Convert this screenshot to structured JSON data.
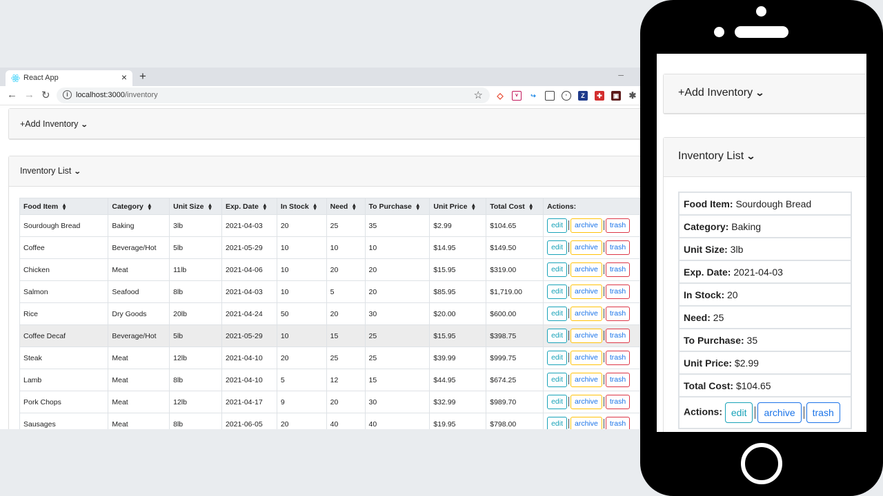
{
  "browser": {
    "tab_title": "React App",
    "url_host": "localhost:3000",
    "url_path": "/inventory"
  },
  "add_inventory_label": "+Add Inventory",
  "inventory_list_label": "Inventory List",
  "actions_header": "Actions:",
  "buttons": {
    "edit": "edit",
    "archive": "archive",
    "trash": "trash"
  },
  "columns": [
    "Food Item",
    "Category",
    "Unit Size",
    "Exp. Date",
    "In Stock",
    "Need",
    "To Purchase",
    "Unit Price",
    "Total Cost"
  ],
  "rows": [
    [
      "Sourdough Bread",
      "Baking",
      "3lb",
      "2021-04-03",
      "20",
      "25",
      "35",
      "$2.99",
      "$104.65"
    ],
    [
      "Coffee",
      "Beverage/Hot",
      "5lb",
      "2021-05-29",
      "10",
      "10",
      "10",
      "$14.95",
      "$149.50"
    ],
    [
      "Chicken",
      "Meat",
      "11lb",
      "2021-04-06",
      "10",
      "20",
      "20",
      "$15.95",
      "$319.00"
    ],
    [
      "Salmon",
      "Seafood",
      "8lb",
      "2021-04-03",
      "10",
      "5",
      "20",
      "$85.95",
      "$1,719.00"
    ],
    [
      "Rice",
      "Dry Goods",
      "20lb",
      "2021-04-24",
      "50",
      "20",
      "30",
      "$20.00",
      "$600.00"
    ],
    [
      "Coffee Decaf",
      "Beverage/Hot",
      "5lb",
      "2021-05-29",
      "10",
      "15",
      "25",
      "$15.95",
      "$398.75"
    ],
    [
      "Steak",
      "Meat",
      "12lb",
      "2021-04-10",
      "20",
      "25",
      "25",
      "$39.99",
      "$999.75"
    ],
    [
      "Lamb",
      "Meat",
      "8lb",
      "2021-04-10",
      "5",
      "12",
      "15",
      "$44.95",
      "$674.25"
    ],
    [
      "Pork Chops",
      "Meat",
      "12lb",
      "2021-04-17",
      "9",
      "20",
      "30",
      "$32.99",
      "$989.70"
    ],
    [
      "Sausages",
      "Meat",
      "8lb",
      "2021-06-05",
      "20",
      "40",
      "40",
      "$19.95",
      "$798.00"
    ]
  ],
  "mobile": {
    "fields": [
      {
        "label": "Food Item:",
        "value": "Sourdough Bread"
      },
      {
        "label": "Category:",
        "value": "Baking"
      },
      {
        "label": "Unit Size:",
        "value": "3lb"
      },
      {
        "label": "Exp. Date:",
        "value": "2021-04-03"
      },
      {
        "label": "In Stock:",
        "value": "20"
      },
      {
        "label": "Need:",
        "value": "25"
      },
      {
        "label": "To Purchase:",
        "value": "35"
      },
      {
        "label": "Unit Price:",
        "value": "$2.99"
      },
      {
        "label": "Total Cost:",
        "value": "$104.65"
      }
    ],
    "actions_label": "Actions:"
  },
  "colors": {
    "edit": "#17a2b8",
    "archive": "#ffc107",
    "trash": "#dc3545",
    "link": "#1a73e8"
  },
  "icons": [
    "react-favicon",
    "close-icon",
    "plus-icon",
    "back-arrow-icon",
    "forward-arrow-icon",
    "reload-icon",
    "info-icon",
    "star-icon",
    "extension-icons",
    "puzzle-icon",
    "chevron-down-icon",
    "sort-icon"
  ]
}
